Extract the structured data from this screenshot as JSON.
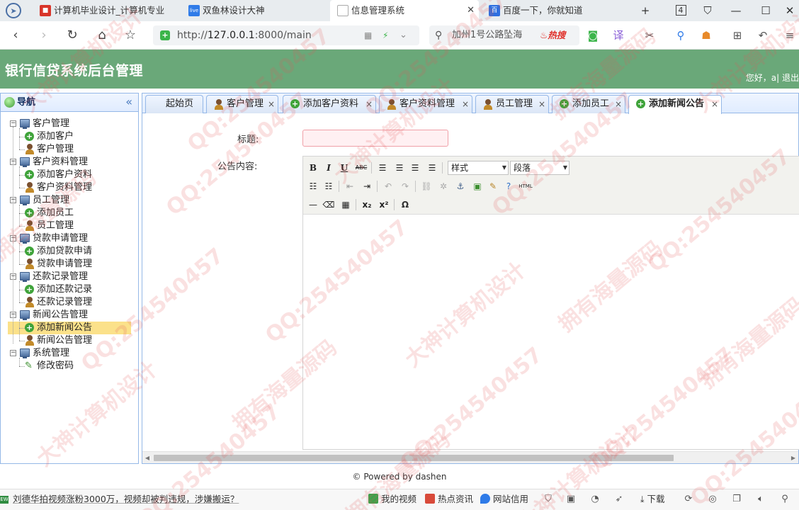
{
  "browser": {
    "tabs": [
      {
        "title": "计算机毕业设计_计算机专业",
        "active": false
      },
      {
        "title": "双鱼林设计大神",
        "active": false
      },
      {
        "title": "信息管理系统",
        "active": true
      },
      {
        "title": "百度一下，你就知道",
        "active": false
      }
    ],
    "tab_count": "4",
    "url_prefix": "http://",
    "url_host": "127.0.0.1",
    "url_path": ":8000/main",
    "search_text": "加州1号公路坠海",
    "search_hot": "热搜"
  },
  "app": {
    "title": "银行信贷系统后台管理",
    "user_greeting": "您好，a| 退出"
  },
  "nav": {
    "title": "导航",
    "groups": [
      {
        "label": "客户管理",
        "items": [
          "添加客户",
          "客户管理"
        ]
      },
      {
        "label": "客户资料管理",
        "items": [
          "添加客户资料",
          "客户资料管理"
        ]
      },
      {
        "label": "员工管理",
        "items": [
          "添加员工",
          "员工管理"
        ]
      },
      {
        "label": "贷款申请管理",
        "items": [
          "添加贷款申请",
          "贷款申请管理"
        ]
      },
      {
        "label": "还款记录管理",
        "items": [
          "添加还款记录",
          "还款记录管理"
        ]
      },
      {
        "label": "新闻公告管理",
        "items": [
          "添加新闻公告",
          "新闻公告管理"
        ]
      },
      {
        "label": "系统管理",
        "items": [
          "修改密码"
        ]
      }
    ],
    "selected": "添加新闻公告"
  },
  "content_tabs": [
    {
      "label": "起始页",
      "icon": "none",
      "closable": false
    },
    {
      "label": "客户管理",
      "icon": "user-icon",
      "closable": true
    },
    {
      "label": "添加客户资料",
      "icon": "add-icon",
      "closable": true
    },
    {
      "label": "客户资料管理",
      "icon": "user-icon",
      "closable": true
    },
    {
      "label": "员工管理",
      "icon": "user-icon",
      "closable": true
    },
    {
      "label": "添加员工",
      "icon": "add-icon",
      "closable": true
    },
    {
      "label": "添加新闻公告",
      "icon": "add-icon",
      "closable": true,
      "active": true
    }
  ],
  "form": {
    "title_label": "标题:",
    "title_value": "",
    "content_label": "公告内容:",
    "style_select": "样式",
    "paragraph_select": "段落"
  },
  "footer": "© Powered by dashen",
  "statusbar": {
    "news_badge": "EW",
    "news": "刘德华拍视频涨粉3000万，视频却被判违规，涉嫌搬运？",
    "items": [
      "我的视频",
      "热点资讯",
      "网站信用",
      "下载"
    ]
  },
  "watermarks": [
    "大神计算机设计",
    "QQ:254540457",
    "拥有海量源码"
  ]
}
